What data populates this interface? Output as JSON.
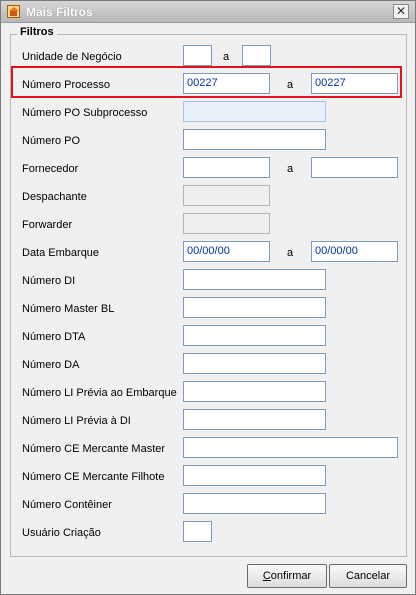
{
  "window": {
    "title": "Mais Filtros",
    "close_glyph": "✕"
  },
  "group": {
    "title": "Filtros"
  },
  "range_separator": "a",
  "fields": {
    "unidade_negocio": {
      "label": "Unidade de Negócio",
      "from": "",
      "to": ""
    },
    "numero_processo": {
      "label": "Número Processo",
      "from": "00227",
      "to": "00227"
    },
    "numero_po_subprocesso": {
      "label": "Número PO Subprocesso",
      "value": ""
    },
    "numero_po": {
      "label": "Número PO",
      "value": ""
    },
    "fornecedor": {
      "label": "Fornecedor",
      "from": "",
      "to": ""
    },
    "despachante": {
      "label": "Despachante",
      "value": ""
    },
    "forwarder": {
      "label": "Forwarder",
      "value": ""
    },
    "data_embarque": {
      "label": "Data Embarque",
      "from": "00/00/00",
      "to": "00/00/00"
    },
    "numero_di": {
      "label": "Número DI",
      "value": ""
    },
    "numero_master_bl": {
      "label": "Número Master BL",
      "value": ""
    },
    "numero_dta": {
      "label": "Número DTA",
      "value": ""
    },
    "numero_da": {
      "label": "Número DA",
      "value": ""
    },
    "numero_li_previa_embarque": {
      "label": "Número LI Prévia ao Embarque",
      "value": ""
    },
    "numero_li_previa_di": {
      "label": "Número LI Prévia à DI",
      "value": ""
    },
    "numero_ce_mercante_master": {
      "label": "Número CE Mercante Master",
      "value": ""
    },
    "numero_ce_mercante_filhote": {
      "label": "Número CE Mercante Filhote",
      "value": ""
    },
    "numero_conteiner": {
      "label": "Número Contêiner",
      "value": ""
    },
    "usuario_criacao": {
      "label": "Usuário Criação",
      "value": ""
    }
  },
  "buttons": {
    "confirm_mnemonic": "C",
    "confirm_rest": "onfirmar",
    "cancel": "Cancelar"
  },
  "colors": {
    "highlight": "#e1121b",
    "field_text": "#003399"
  },
  "icons": {
    "app": "house-icon",
    "close": "close-icon"
  }
}
